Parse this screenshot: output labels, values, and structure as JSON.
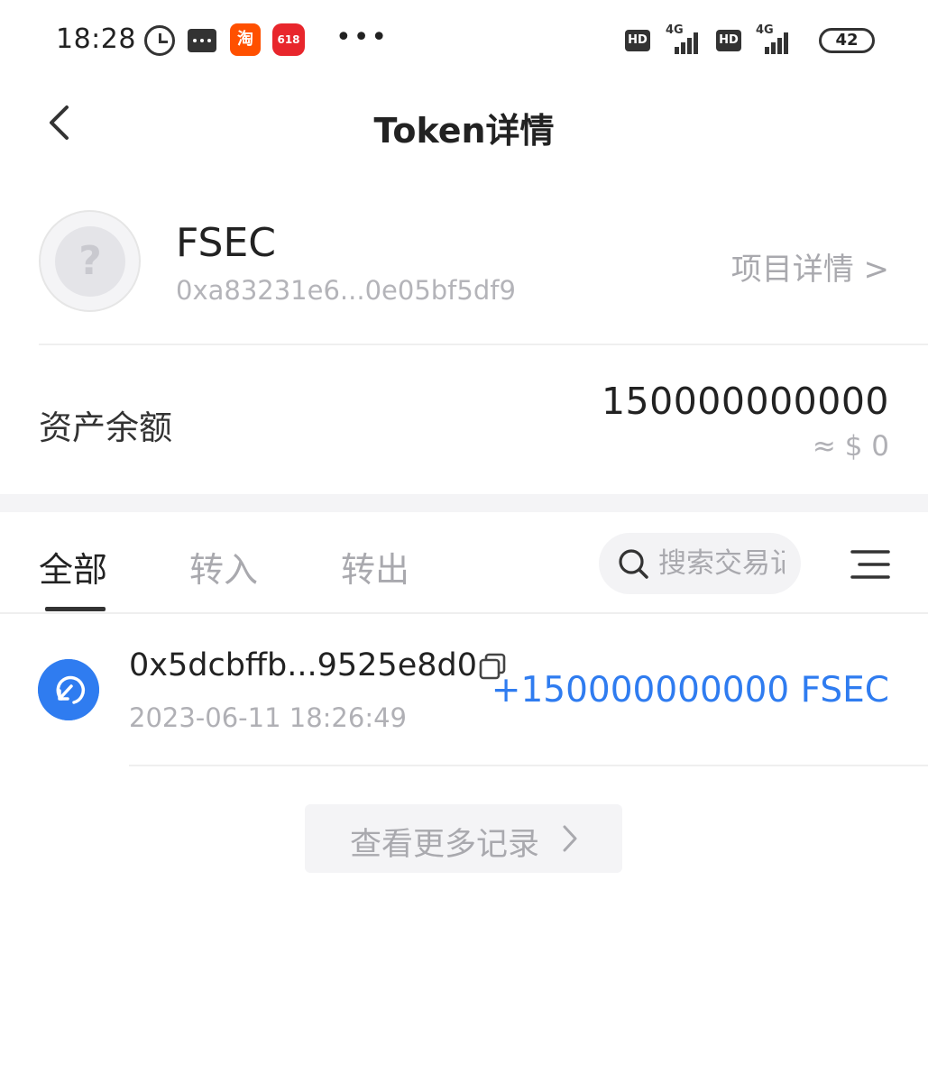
{
  "status_bar": {
    "time": "18:28",
    "app1_label": "淘",
    "app2_label": "618",
    "more": "•••",
    "network1": "HD",
    "network2": "HD",
    "signal_type1": "4G",
    "signal_type2": "4G",
    "battery": "42"
  },
  "header": {
    "title": "Token详情"
  },
  "token": {
    "symbol": "FSEC",
    "address": "0xa83231e6...0e05bf5df9",
    "project_link": "项目详情 >",
    "avatar_placeholder": "?"
  },
  "balance": {
    "label": "资产余额",
    "value": "150000000000",
    "usd": "≈ $  0"
  },
  "tabs": [
    {
      "label": "全部",
      "active": true
    },
    {
      "label": "转入",
      "active": false
    },
    {
      "label": "转出",
      "active": false
    }
  ],
  "search": {
    "placeholder": "搜索交易记录"
  },
  "transactions": [
    {
      "hash": "0x5dcbffb...9525e8d0",
      "date": "2023-06-11 18:26:49",
      "amount": "+150000000000 FSEC",
      "direction": "in"
    }
  ],
  "more_button": {
    "label": "查看更多记录"
  },
  "colors": {
    "accent": "#2f7cf0",
    "text_primary": "#222222",
    "text_secondary": "#a9a9ae",
    "divider": "#efefef"
  }
}
